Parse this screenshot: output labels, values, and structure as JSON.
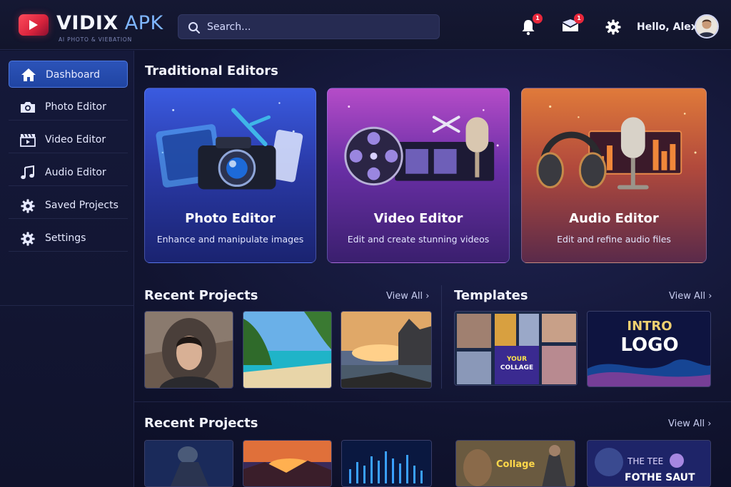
{
  "app": {
    "name_main": "VIDIX",
    "name_accent": " APK",
    "tagline": "AI PHOTO & VIEBATION"
  },
  "search": {
    "placeholder": "Search..."
  },
  "header": {
    "notifications_count": "1",
    "messages_count": "1",
    "greeting": "Hello, Alex"
  },
  "sidebar": {
    "items": [
      {
        "label": "Dashboard",
        "icon": "home-icon",
        "active": true
      },
      {
        "label": "Photo Editor",
        "icon": "camera-icon"
      },
      {
        "label": "Video Editor",
        "icon": "clapperboard-icon"
      },
      {
        "label": "Audio Editor",
        "icon": "music-note-icon"
      },
      {
        "label": "Saved Projects",
        "icon": "gear-icon"
      },
      {
        "label": "Settings",
        "icon": "gear-icon"
      }
    ]
  },
  "editors": {
    "title": "Traditional Editors",
    "cards": [
      {
        "title": "Photo Editor",
        "desc": "Enhance and manipulate images"
      },
      {
        "title": "Video Editor",
        "desc": "Edit and create stunning videos"
      },
      {
        "title": "Audio Editor",
        "desc": "Edit and refine audio files"
      }
    ]
  },
  "recent": {
    "title": "Recent Projects",
    "view_all": "View All"
  },
  "templates": {
    "title": "Templates",
    "view_all": "View All",
    "collage_text_1": "YOUR",
    "collage_text_2": "COLLAGE",
    "intro_text_1": "INTRO",
    "intro_text_2": "LOGO"
  },
  "recent2": {
    "title": "Recent Projects",
    "view_all": "View All",
    "collage_label": "Collage",
    "tee_text_1": "THE TEE",
    "tee_text_2": "FOTHE SAUT"
  },
  "colors": {
    "accent": "#2c53b8",
    "badge": "#e8273b",
    "brand": "#ff4b5c"
  }
}
